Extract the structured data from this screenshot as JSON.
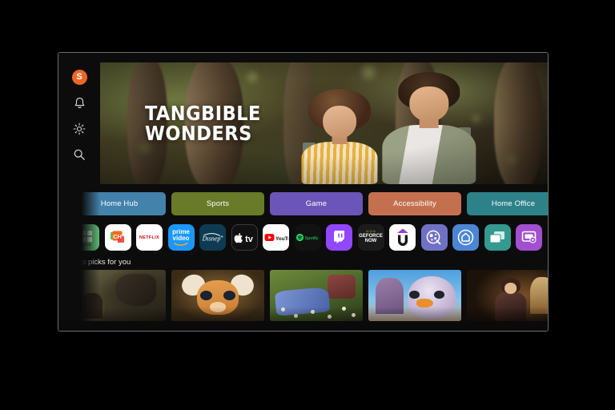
{
  "device": {
    "name": "smart-tv",
    "bezel_color": "#6e6e6e"
  },
  "rail": {
    "avatar": {
      "initial": "S",
      "color": "#ec6726",
      "name": "profile-avatar"
    },
    "items": [
      {
        "icon": "bell-icon",
        "label": "Notifications"
      },
      {
        "icon": "gear-icon",
        "label": "Settings"
      },
      {
        "icon": "search-icon",
        "label": "Search"
      }
    ]
  },
  "hero": {
    "title_line1": "TANGBIBLE",
    "title_line2": "WONDERS",
    "description": "Two people standing in a sunlit forest"
  },
  "categories": [
    {
      "label": "Home Hub",
      "color": "#4382ab"
    },
    {
      "label": "Sports",
      "color": "#697a28"
    },
    {
      "label": "Game",
      "color": "#6b55b8"
    },
    {
      "label": "Accessibility",
      "color": "#c4704f"
    },
    {
      "label": "Home Office",
      "color": "#2c8288"
    }
  ],
  "apps": [
    {
      "name": "apps-grid",
      "label": "APPS",
      "bg": "#63c17a",
      "fg": "#ffffff"
    },
    {
      "name": "channels-ch",
      "label": "CH",
      "bg": "#ffffff",
      "fg": "#e8512b"
    },
    {
      "name": "netflix",
      "label": "NETFLIX",
      "bg": "#ffffff",
      "fg": "#e50914"
    },
    {
      "name": "prime-video",
      "label": "prime video",
      "bg": "#1a98ff",
      "fg": "#ffffff"
    },
    {
      "name": "disney-plus",
      "label": "Disney+",
      "bg": "#0d3b52",
      "fg": "#ffffff"
    },
    {
      "name": "apple-tv",
      "label": "tv",
      "bg": "#111111",
      "fg": "#ffffff"
    },
    {
      "name": "youtube",
      "label": "YouTube",
      "bg": "#ffffff",
      "fg": "#ff0000"
    },
    {
      "name": "spotify",
      "label": "Spotify",
      "bg": "#121212",
      "fg": "#1ed760"
    },
    {
      "name": "twitch",
      "label": "Twitch",
      "bg": "#9146ff",
      "fg": "#ffffff"
    },
    {
      "name": "geforce-now",
      "label": "GEFORCE NOW",
      "bg": "#1b1b1b",
      "fg": "#ffffff"
    },
    {
      "name": "u-app",
      "label": "U",
      "bg": "#ffffff",
      "fg": "#1a1a1a"
    },
    {
      "name": "gaming-hub",
      "label": "Gaming Hub",
      "bg": "#6f72c4",
      "fg": "#ffffff"
    },
    {
      "name": "smartthings",
      "label": "SmartThings",
      "bg": "#4b86d4",
      "fg": "#ffffff"
    },
    {
      "name": "multi-view",
      "label": "Multi View",
      "bg": "#34998f",
      "fg": "#ffffff"
    },
    {
      "name": "screen-mirror",
      "label": "Screen Share",
      "bg": "#a24fd0",
      "fg": "#ffffff"
    }
  ],
  "picks": {
    "title": "Top picks for you",
    "items": [
      {
        "name": "pick-dragon",
        "description": "Knight facing a dragon in a forest"
      },
      {
        "name": "pick-giraffe",
        "description": "Animated baby giraffe close-up"
      },
      {
        "name": "pick-meadow",
        "description": "Picnic in a flowering meadow"
      },
      {
        "name": "pick-bird",
        "description": "Purple animated bird with castle"
      },
      {
        "name": "pick-drama",
        "description": "Woman in period costume indoors"
      }
    ]
  }
}
